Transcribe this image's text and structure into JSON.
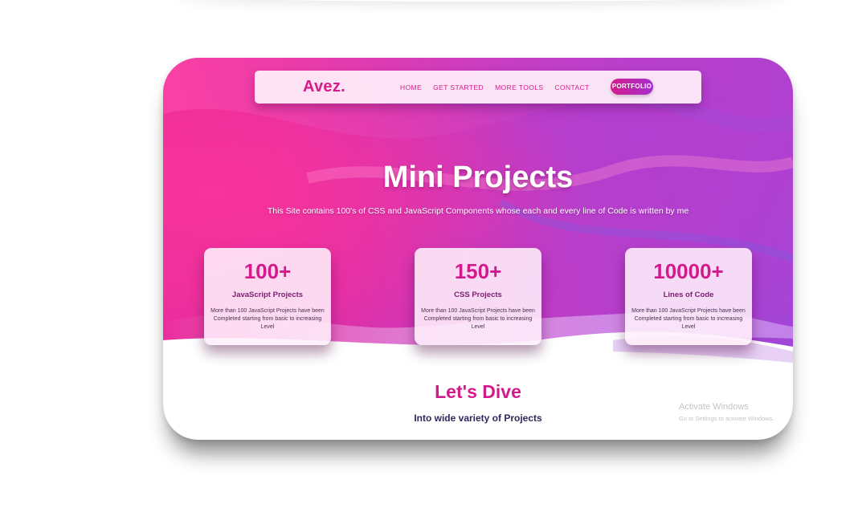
{
  "nav": {
    "logo": "Avez",
    "logo_dot": ".",
    "links": [
      "HOME",
      "GET STARTED",
      "MORE TOOLS",
      "CONTACT"
    ],
    "portfolio": "PORTFOLIO"
  },
  "hero": {
    "title": "Mini Projects",
    "subtitle": "This Site contains 100's of CSS and JavaScript Components whose each and every line of Code is written by me"
  },
  "stats": [
    {
      "number": "100+",
      "label": "JavaScript Projects",
      "desc": "More than 100 JavaScript Projects have been Completed starting from basic to increasing Level"
    },
    {
      "number": "150+",
      "label": "CSS Projects",
      "desc": "More than 100 JavaScript Projects have been Completed starting from basic to increasing Level"
    },
    {
      "number": "10000+",
      "label": "Lines of Code",
      "desc": "More than 100 JavaScript Projects have been Completed starting from basic to increasing Level"
    }
  ],
  "dive": {
    "title": "Let's Dive",
    "subtitle": "Into wide variety of Projects"
  },
  "watermark": {
    "title": "Activate Windows",
    "subtitle": "Go to Settings to activate Windows."
  },
  "colors": {
    "accent": "#d31a8c",
    "gradient_start": "#f02c95",
    "gradient_end": "#9b47d9"
  }
}
